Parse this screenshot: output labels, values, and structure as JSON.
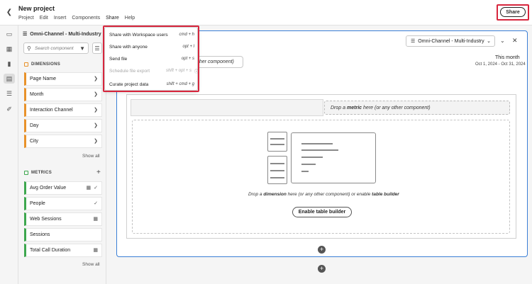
{
  "header": {
    "project_title": "New project",
    "menus": [
      "Project",
      "Edit",
      "Insert",
      "Components",
      "Share",
      "Help"
    ],
    "share_button": "Share"
  },
  "rail": {
    "icons": [
      "panel-icon",
      "visualization-icon",
      "chart-icon",
      "components-icon",
      "list-icon",
      "brush-icon"
    ]
  },
  "components_panel": {
    "dataview": "Omni-Channel - Multi-Industry",
    "search_placeholder": "Search component",
    "dimensions_header": "DIMENSIONS",
    "dimensions": [
      "Page Name",
      "Month",
      "Interaction Channel",
      "Day",
      "City"
    ],
    "dimensions_show_all": "Show all",
    "metrics_header": "METRICS",
    "metrics": [
      {
        "label": "Avg Order Value",
        "icons": [
          "calc-icon",
          "check-icon"
        ]
      },
      {
        "label": "People",
        "icons": [
          "check-icon"
        ]
      },
      {
        "label": "Web Sessions",
        "icons": [
          "calc-icon"
        ]
      },
      {
        "label": "Sessions",
        "icons": []
      },
      {
        "label": "Total Call Duration",
        "icons": [
          "calc-icon"
        ]
      }
    ],
    "metrics_show_all": "Show all"
  },
  "panel": {
    "dataview_select": "Omni-Channel - Multi-Industry",
    "dropzone_hint": "other component)",
    "date_label": "This month",
    "date_range": "Oct 1, 2024 - Oct 31, 2024",
    "metric_drop_prefix": "Drop a ",
    "metric_drop_bold": "metric",
    "metric_drop_suffix": " here (or any other component)",
    "dimension_drop_prefix": "Drop a ",
    "dimension_drop_bold": "dimension",
    "dimension_drop_mid": " here (or any other component) or enable ",
    "dimension_drop_bold2": "table builder",
    "enable_button": "Enable table builder"
  },
  "share_menu": {
    "items": [
      {
        "label": "Share with Workspace users",
        "shortcut": "cmd + h",
        "disabled": false
      },
      {
        "label": "Share with anyone",
        "shortcut": "opt + l",
        "disabled": false
      },
      {
        "label": "Send file",
        "shortcut": "opt + s",
        "disabled": false
      },
      {
        "label": "Schedule file export",
        "shortcut": "shift + opt + s",
        "disabled": true
      },
      {
        "label": "Curate project data",
        "shortcut": "shift + cmd + g",
        "disabled": false
      }
    ]
  },
  "colors": {
    "dimension_accent": "#e8922a",
    "metric_accent": "#3da74e",
    "panel_border": "#3b7fd6",
    "highlight": "#d7263d"
  }
}
